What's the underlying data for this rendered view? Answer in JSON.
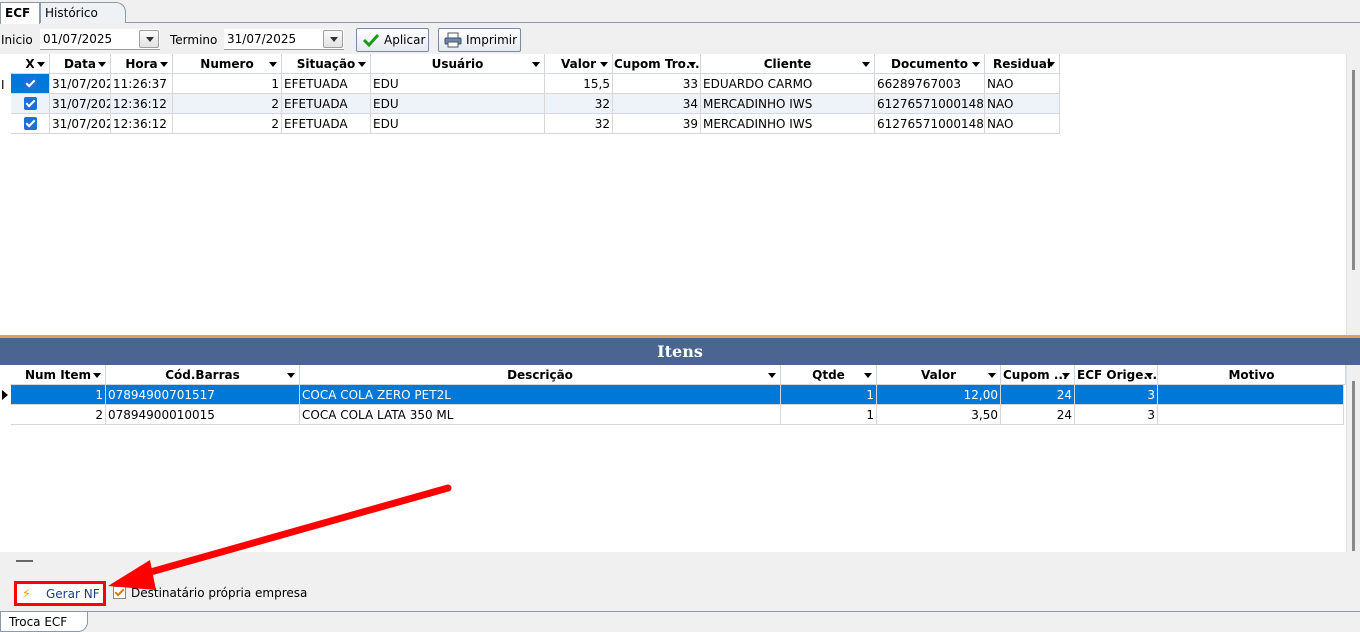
{
  "tabs": {
    "ecf": "ECF",
    "historico": "Histórico"
  },
  "filter": {
    "inicio_label": "Inicio",
    "inicio_value": "01/07/2025",
    "termino_label": "Termino",
    "termino_value": "31/07/2025",
    "aplicar": "Aplicar",
    "imprimir": "Imprimir"
  },
  "ecf_grid": {
    "columns": [
      "X",
      "Data",
      "Hora",
      "Numero",
      "Situação",
      "Usuário",
      "Valor",
      "Cupom Tro...",
      "Cliente",
      "Documento",
      "Residual"
    ],
    "rows": [
      {
        "checked": true,
        "data": "31/07/202",
        "hora": "11:26:37",
        "numero": "1",
        "situacao": "EFETUADA",
        "usuario": "EDU",
        "valor": "15,5",
        "cupom": "33",
        "cliente": "EDUARDO CARMO",
        "documento": "66289767003",
        "residual": "NAO"
      },
      {
        "checked": true,
        "data": "31/07/202",
        "hora": "12:36:12",
        "numero": "2",
        "situacao": "EFETUADA",
        "usuario": "EDU",
        "valor": "32",
        "cupom": "34",
        "cliente": "MERCADINHO IWS",
        "documento": "61276571000148",
        "residual": "NAO"
      },
      {
        "checked": true,
        "data": "31/07/202",
        "hora": "12:36:12",
        "numero": "2",
        "situacao": "EFETUADA",
        "usuario": "EDU",
        "valor": "32",
        "cupom": "39",
        "cliente": "MERCADINHO IWS",
        "documento": "61276571000148",
        "residual": "NAO"
      }
    ]
  },
  "itens_title": "Itens",
  "itens_grid": {
    "columns": [
      "Num Item",
      "Cód.Barras",
      "Descrição",
      "Qtde",
      "Valor",
      "Cupom ...",
      "ECF Orige...",
      "Motivo"
    ],
    "rows": [
      {
        "num": "1",
        "barras": "07894900701517",
        "descricao": "COCA COLA ZERO PET2L",
        "qtde": "1",
        "valor": "12,00",
        "cupom": "24",
        "ecf": "3",
        "motivo": ""
      },
      {
        "num": "2",
        "barras": "07894900010015",
        "descricao": "COCA COLA LATA 350 ML",
        "qtde": "1",
        "valor": "3,50",
        "cupom": "24",
        "ecf": "3",
        "motivo": ""
      }
    ]
  },
  "bottom": {
    "gerar_nf": "Gerar NF",
    "destinatario": "Destinatário própria empresa",
    "checked": true
  },
  "bottom_tab": "Troca ECF",
  "colors": {
    "selection": "#0078d7",
    "itens_header": "#4a6690",
    "highlight": "#ff0000",
    "splitter": "#e8a050"
  }
}
